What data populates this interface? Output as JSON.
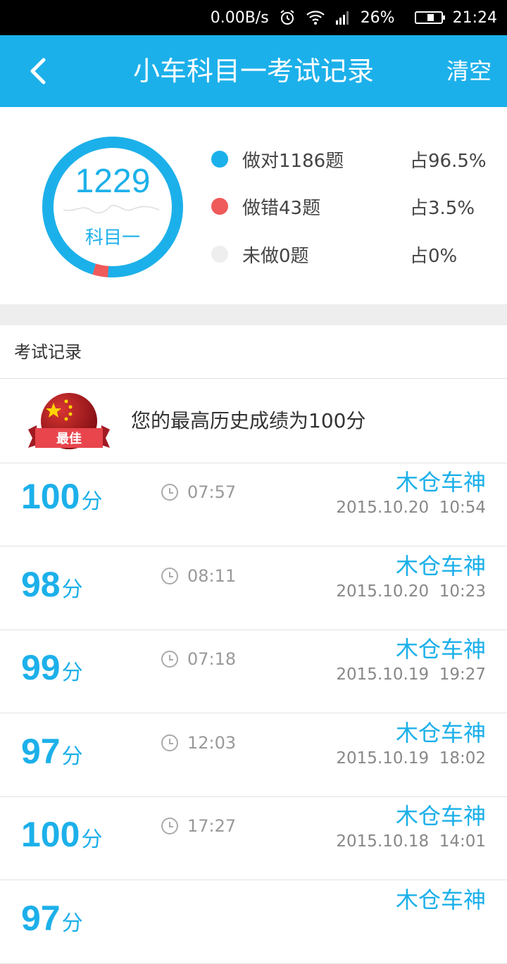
{
  "status_bar": {
    "net_speed": "0.00B/s",
    "battery_pct": "26%",
    "time": "21:24",
    "icons": [
      "alarm-icon",
      "wifi-icon",
      "signal-icon",
      "battery-icon"
    ]
  },
  "header": {
    "title": "小车科目一考试记录",
    "clear_label": "清空",
    "back_icon": "chevron-left-icon",
    "bg_color": "#1cb0ea"
  },
  "summary": {
    "total": "1229",
    "subject": "科目一",
    "correct_ratio": 0.965,
    "wrong_ratio": 0.035,
    "items": [
      {
        "label": "做对1186题",
        "percent": "占96.5%",
        "color": "#1cb0ea"
      },
      {
        "label": "做错43题",
        "percent": "占3.5%",
        "color": "#ef5a5a"
      },
      {
        "label": "未做0题",
        "percent": "占0%",
        "color": "#eeeeee"
      }
    ]
  },
  "section_title": "考试记录",
  "best": {
    "badge_text": "最佳",
    "text": "您的最高历史成绩为100分"
  },
  "records": [
    {
      "score": "100",
      "unit": "分",
      "duration": "07:57",
      "user": "木仓车神",
      "date": "2015.10.20  10:54"
    },
    {
      "score": "98",
      "unit": "分",
      "duration": "08:11",
      "user": "木仓车神",
      "date": "2015.10.20  10:23"
    },
    {
      "score": "99",
      "unit": "分",
      "duration": "07:18",
      "user": "木仓车神",
      "date": "2015.10.19  19:27"
    },
    {
      "score": "97",
      "unit": "分",
      "duration": "12:03",
      "user": "木仓车神",
      "date": "2015.10.19  18:02"
    },
    {
      "score": "100",
      "unit": "分",
      "duration": "17:27",
      "user": "木仓车神",
      "date": "2015.10.18  14:01"
    },
    {
      "score": "97",
      "unit": "分",
      "duration": "",
      "user": "木仓车神",
      "date": ""
    }
  ]
}
